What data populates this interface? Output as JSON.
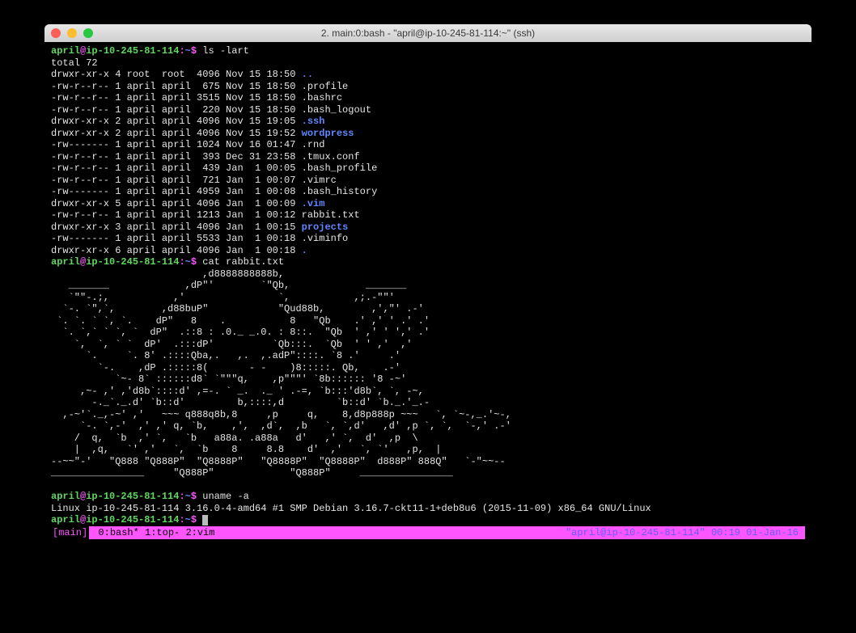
{
  "window": {
    "title": "2. main:0:bash - \"april@ip-10-245-81-114:~\" (ssh)"
  },
  "prompt": {
    "user": "april",
    "at": "@",
    "host": "ip-10-245-81-114",
    "path": "~",
    "tail": "$"
  },
  "commands": {
    "cmd1": " ls -lart",
    "cmd2": " cat rabbit.txt",
    "cmd3": " uname -a",
    "cmd4": " "
  },
  "ls": {
    "total": "total 72",
    "rows": [
      {
        "perm": "drwxr-xr-x",
        "links": "4",
        "owner": "root ",
        "group": "root ",
        "size": "4096",
        "date": "Nov 15 18:50",
        "name": "..",
        "dir": true
      },
      {
        "perm": "-rw-r--r--",
        "links": "1",
        "owner": "april",
        "group": "april",
        "size": " 675",
        "date": "Nov 15 18:50",
        "name": ".profile",
        "dir": false
      },
      {
        "perm": "-rw-r--r--",
        "links": "1",
        "owner": "april",
        "group": "april",
        "size": "3515",
        "date": "Nov 15 18:50",
        "name": ".bashrc",
        "dir": false
      },
      {
        "perm": "-rw-r--r--",
        "links": "1",
        "owner": "april",
        "group": "april",
        "size": " 220",
        "date": "Nov 15 18:50",
        "name": ".bash_logout",
        "dir": false
      },
      {
        "perm": "drwxr-xr-x",
        "links": "2",
        "owner": "april",
        "group": "april",
        "size": "4096",
        "date": "Nov 15 19:05",
        "name": ".ssh",
        "dir": true
      },
      {
        "perm": "drwxr-xr-x",
        "links": "2",
        "owner": "april",
        "group": "april",
        "size": "4096",
        "date": "Nov 15 19:52",
        "name": "wordpress",
        "dir": true
      },
      {
        "perm": "-rw-------",
        "links": "1",
        "owner": "april",
        "group": "april",
        "size": "1024",
        "date": "Nov 16 01:47",
        "name": ".rnd",
        "dir": false
      },
      {
        "perm": "-rw-r--r--",
        "links": "1",
        "owner": "april",
        "group": "april",
        "size": " 393",
        "date": "Dec 31 23:58",
        "name": ".tmux.conf",
        "dir": false
      },
      {
        "perm": "-rw-r--r--",
        "links": "1",
        "owner": "april",
        "group": "april",
        "size": " 439",
        "date": "Jan  1 00:05",
        "name": ".bash_profile",
        "dir": false
      },
      {
        "perm": "-rw-r--r--",
        "links": "1",
        "owner": "april",
        "group": "april",
        "size": " 721",
        "date": "Jan  1 00:07",
        "name": ".vimrc",
        "dir": false
      },
      {
        "perm": "-rw-------",
        "links": "1",
        "owner": "april",
        "group": "april",
        "size": "4959",
        "date": "Jan  1 00:08",
        "name": ".bash_history",
        "dir": false
      },
      {
        "perm": "drwxr-xr-x",
        "links": "5",
        "owner": "april",
        "group": "april",
        "size": "4096",
        "date": "Jan  1 00:09",
        "name": ".vim",
        "dir": true
      },
      {
        "perm": "-rw-r--r--",
        "links": "1",
        "owner": "april",
        "group": "april",
        "size": "1213",
        "date": "Jan  1 00:12",
        "name": "rabbit.txt",
        "dir": false
      },
      {
        "perm": "drwxr-xr-x",
        "links": "3",
        "owner": "april",
        "group": "april",
        "size": "4096",
        "date": "Jan  1 00:15",
        "name": "projects",
        "dir": true
      },
      {
        "perm": "-rw-------",
        "links": "1",
        "owner": "april",
        "group": "april",
        "size": "5533",
        "date": "Jan  1 00:18",
        "name": ".viminfo",
        "dir": false
      },
      {
        "perm": "drwxr-xr-x",
        "links": "6",
        "owner": "april",
        "group": "april",
        "size": "4096",
        "date": "Jan  1 00:18",
        "name": ".",
        "dir": true
      }
    ]
  },
  "rabbit": "                          ,d8888888888b,\n   _______             ,dP\"'        `\"Qb,             _______\n   `\"\"-.;,           ,'                `,           ,;.-\"\"'\n  `-. `\",`,        ,d88buP\"            \"Qud88b,        ,',\"' .-'\n `. `. ` `, `.    dP\"   8    .           8   \"Qb    .' ,' ' .' .'\n  `. `,` ` `, `  dP\"  .::8 : .0._ _.0. : 8::.  \"Qb  ' ,' ' ',' .'\n    `,  `, ` `  dP'  .:::dP'          `Qb:::.  `Qb  ' ' ,'  ,'\n      `.     `. 8' .::::Qba,.   ,.  ,.adP\"::::. `8 .'     .'\n        `-.    ,dP .:::::8(       - -    )8:::::. Qb,    .-'\n           `~- 8` ::::::d8` `\"\"\"q,    ,p\"\"\"' `8b:::::: '8 -~'\n     ,~- ,' ,'d8b`::::d' ,=-. ` _.  ._ ' .-=, `b:::'d8b`, `, -~,\n       -._`._.d' `b::d'         b,::::,d         `b::d' `b._.'_.-\n  ,-~'`._,-~' ,'   ~~~ q888q8b,8     ,p     q,    8,d8p888p ~~~   `, `~-,_.'~-,\n     `-. `,-'  ,' ,' q, `b,    ,',  ,d`,  ,b   `, `,d'   ,d' ,p `, `,  `-,' .-'\n    /  q,  `b  ,' `,   `b   a88a. .a88a   d'   ,' `,  d'  ,p  \\\n    |  ,q,   `' ,'   `,  `b    8     8.8    d'  ,'   `, `'   ,p,  |\n--~~\"-'   \"Q888 \"Q888P\"  \"Q8888P\"   \"Q8888P\"  \"Q8888P\"  d888P\" 888Q\"   `-\"~~--\n________________     \"Q888P\"             \"Q888P\"     ________________",
  "uname": {
    "output": "Linux ip-10-245-81-114 3.16.0-4-amd64 #1 SMP Debian 3.16.7-ckt11-1+deb8u6 (2015-11-09) x86_64 GNU/Linux"
  },
  "status": {
    "session": "[main]",
    "windows": " 0:bash* 1:top- 2:vim",
    "right": "\"april@ip-10-245-81-114\" 00:19 01-Jan-16"
  }
}
